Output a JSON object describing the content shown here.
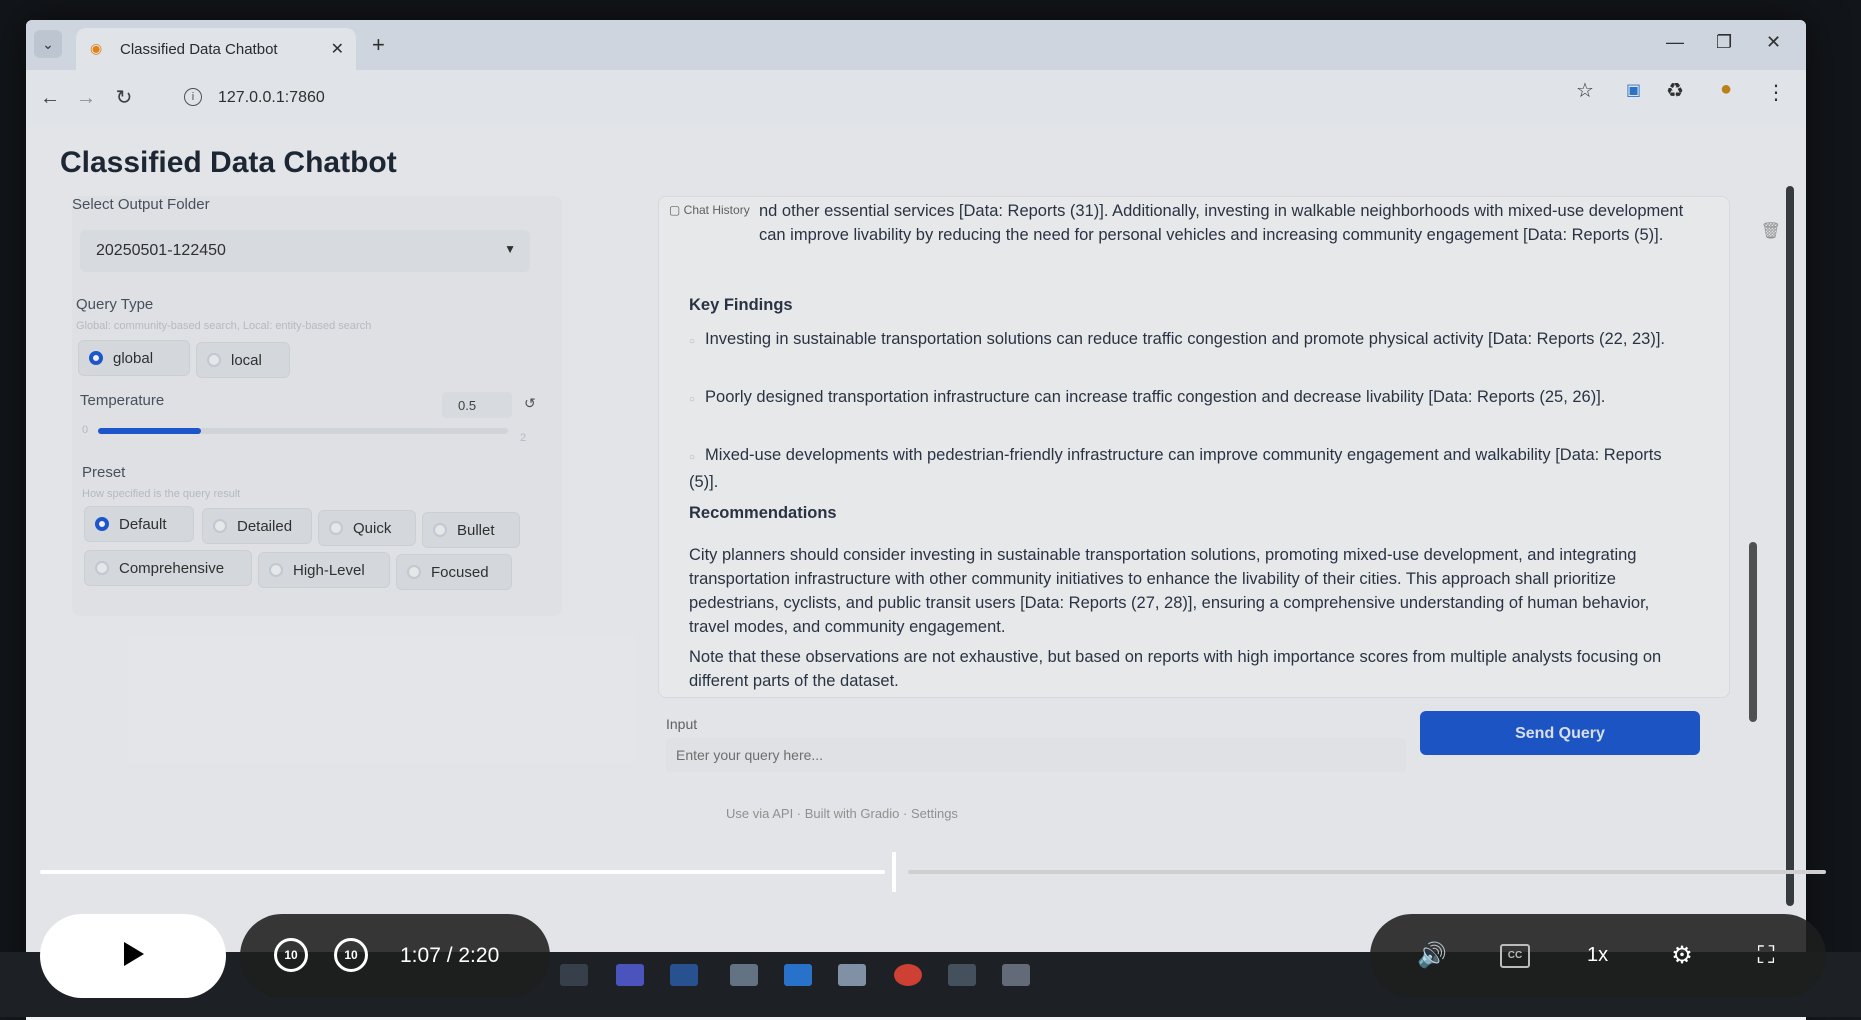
{
  "browser": {
    "tab_title": "Classified Data Chatbot",
    "url": "127.0.0.1:7860"
  },
  "app": {
    "title": "Classified Data Chatbot",
    "output_folder": {
      "label": "Select Output Folder",
      "value": "20250501-122450"
    },
    "query_type": {
      "label": "Query Type",
      "info": "Global: community-based search, Local: entity-based search",
      "options": [
        "global",
        "local"
      ],
      "selected": "global"
    },
    "temperature": {
      "label": "Temperature",
      "value": "0.5",
      "min": "0",
      "max": "2",
      "fraction": 0.25
    },
    "preset": {
      "label": "Preset",
      "info": "How specified is the query result",
      "options": [
        "Default",
        "Detailed",
        "Quick",
        "Bullet",
        "Comprehensive",
        "High-Level",
        "Focused"
      ],
      "selected": "Default"
    },
    "chat": {
      "label": "Chat History",
      "paragraph1": "nd other essential services [Data: Reports (31)]. Additionally, investing in walkable neighborhoods with mixed-use development can improve livability by reducing the need for personal vehicles and increasing community engagement [Data: Reports (5)].",
      "key_findings_heading": "Key Findings",
      "findings": [
        "Investing in sustainable transportation solutions can reduce traffic congestion and promote physical activity [Data: Reports (22, 23)].",
        "Poorly designed transportation infrastructure can increase traffic congestion and decrease livability [Data: Reports (25, 26)].",
        "Mixed-use developments with pedestrian-friendly infrastructure can improve community engagement and walkability [Data: Reports (5)]."
      ],
      "recommendations_heading": "Recommendations",
      "recommendations": "City planners should consider investing in sustainable transportation solutions, promoting mixed-use development, and integrating transportation infrastructure with other community initiatives to enhance the livability of their cities. This approach shall prioritize pedestrians, cyclists, and public transit users [Data: Reports (27, 28)], ensuring a comprehensive understanding of human behavior, travel modes, and community engagement.",
      "note": "Note that these observations are not exhaustive, but based on reports with high importance scores from multiple analysts focusing on different parts of the dataset."
    },
    "input": {
      "label": "Input",
      "placeholder": "Enter your query here..."
    },
    "send_button": "Send Query",
    "footer": "Use via API · Built with Gradio · Settings"
  },
  "video": {
    "time": "1:07 / 2:20",
    "speed": "1x",
    "played_fraction": 0.473
  }
}
